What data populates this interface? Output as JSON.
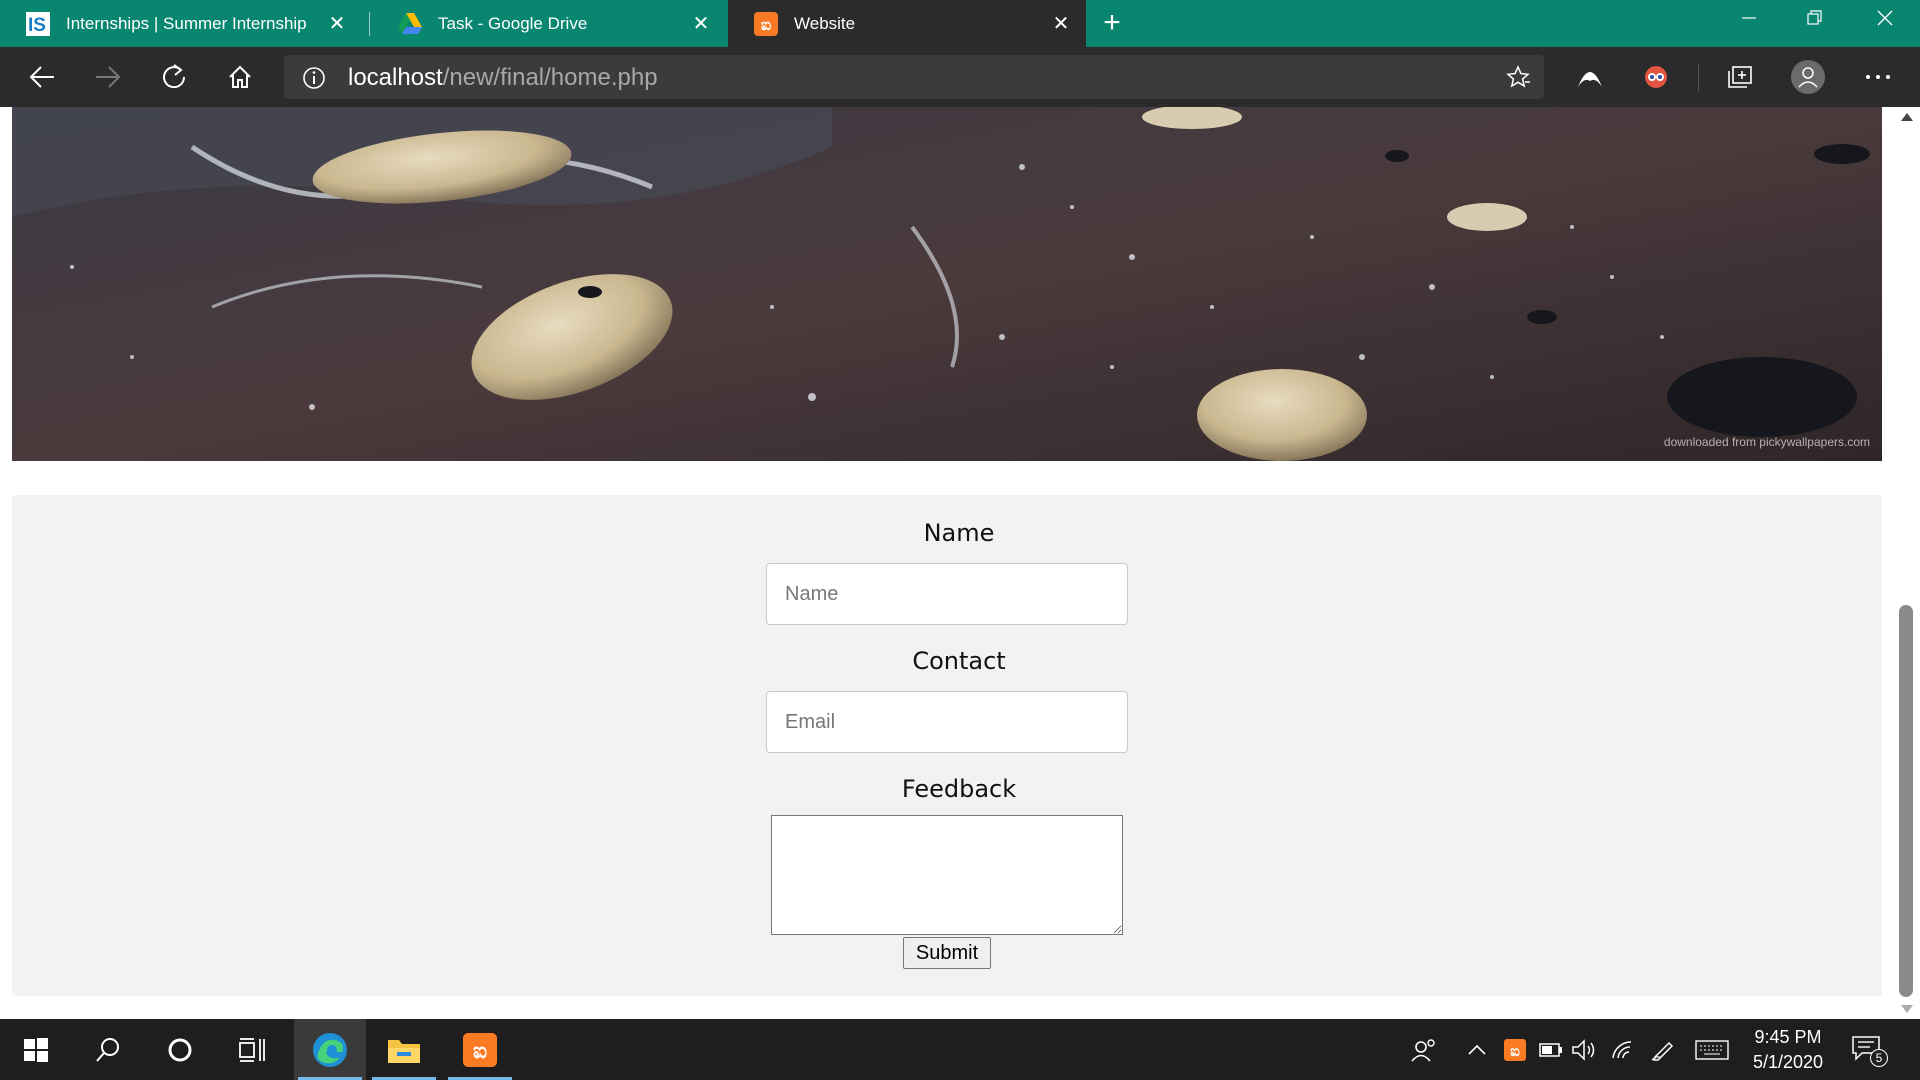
{
  "browser": {
    "tabs": [
      {
        "title": "Internships | Summer Internship",
        "favicon": "internshala-icon"
      },
      {
        "title": "Task - Google Drive",
        "favicon": "google-drive-icon"
      },
      {
        "title": "Website",
        "favicon": "xampp-icon"
      }
    ],
    "active_tab": 2,
    "url_host": "localhost",
    "url_path": "/new/final/home.php",
    "accent_color": "#08866f"
  },
  "page": {
    "hero_watermark": "downloaded from pickywallpapers.com",
    "form": {
      "name_label": "Name",
      "name_placeholder": "Name",
      "contact_label": "Contact",
      "contact_placeholder": "Email",
      "feedback_label": "Feedback",
      "submit_label": "Submit"
    }
  },
  "taskbar": {
    "time": "9:45 PM",
    "date": "5/1/2020",
    "notification_count": "5",
    "pinned": [
      "windows-start-icon",
      "search-icon",
      "cortana-icon",
      "task-view-icon",
      "edge-icon",
      "file-explorer-icon",
      "xampp-icon"
    ]
  }
}
